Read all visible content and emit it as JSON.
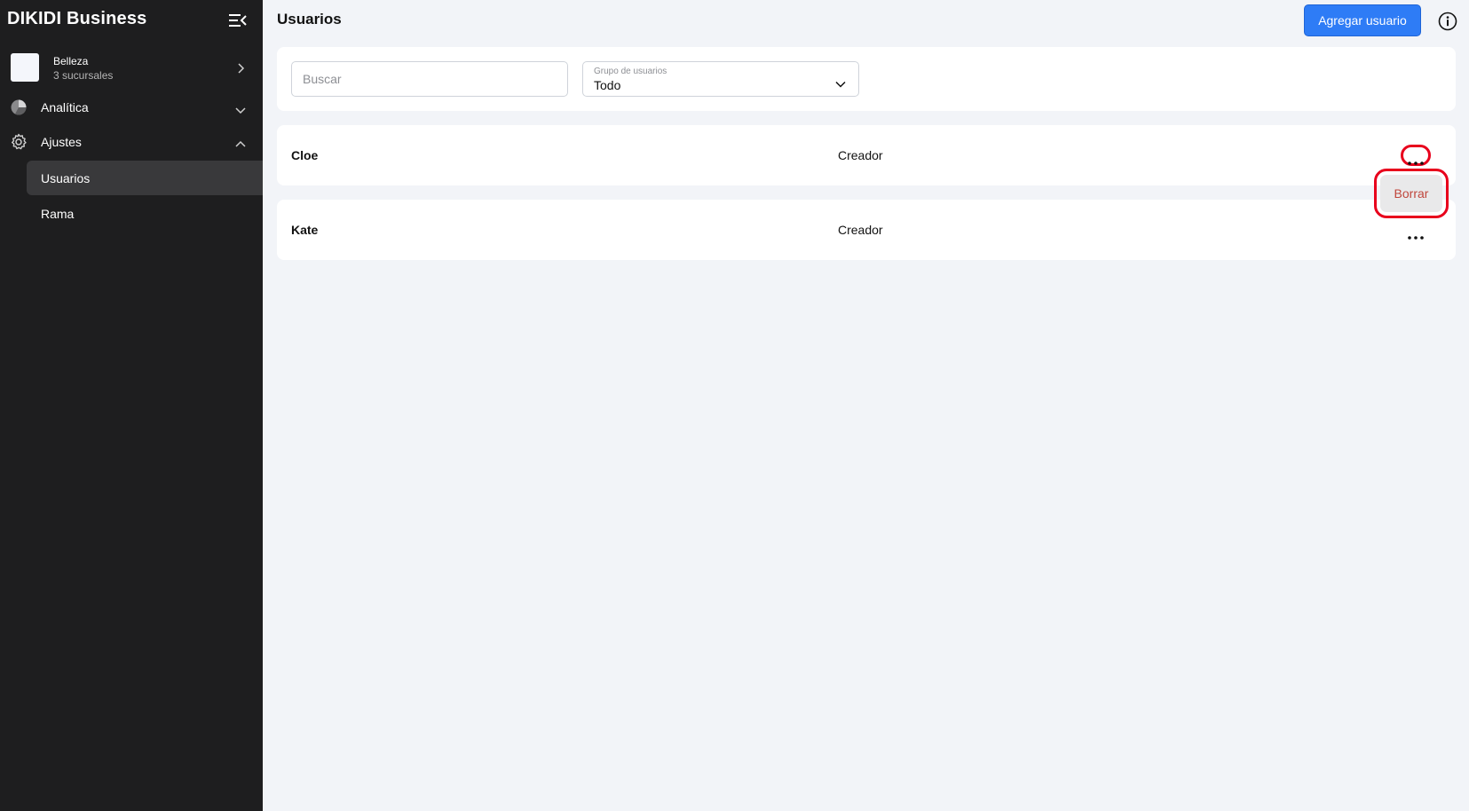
{
  "app": {
    "title": "DIKIDI Business"
  },
  "sidebar": {
    "branch": {
      "name": "Belleza",
      "subtitle": "3 sucursales"
    },
    "items": [
      {
        "label": "Analítica",
        "icon": "pie-chart-icon",
        "expanded": false
      },
      {
        "label": "Ajustes",
        "icon": "gear-icon",
        "expanded": true
      }
    ],
    "subitems": [
      {
        "label": "Usuarios",
        "active": true
      },
      {
        "label": "Rama",
        "active": false
      }
    ]
  },
  "header": {
    "title": "Usuarios",
    "add_button": "Agregar usuario",
    "info_icon": "info-icon"
  },
  "filters": {
    "search": {
      "placeholder": "Buscar",
      "value": ""
    },
    "group": {
      "label": "Grupo de usuarios",
      "value": "Todo"
    }
  },
  "users": [
    {
      "name": "Cloe",
      "role": "Creador"
    },
    {
      "name": "Kate",
      "role": "Creador"
    }
  ],
  "menu": {
    "delete_label": "Borrar"
  },
  "colors": {
    "accent": "#2e7cf6",
    "highlight": "#e8001c",
    "sidebar": "#1e1e1f",
    "danger_text": "#c0463c"
  }
}
